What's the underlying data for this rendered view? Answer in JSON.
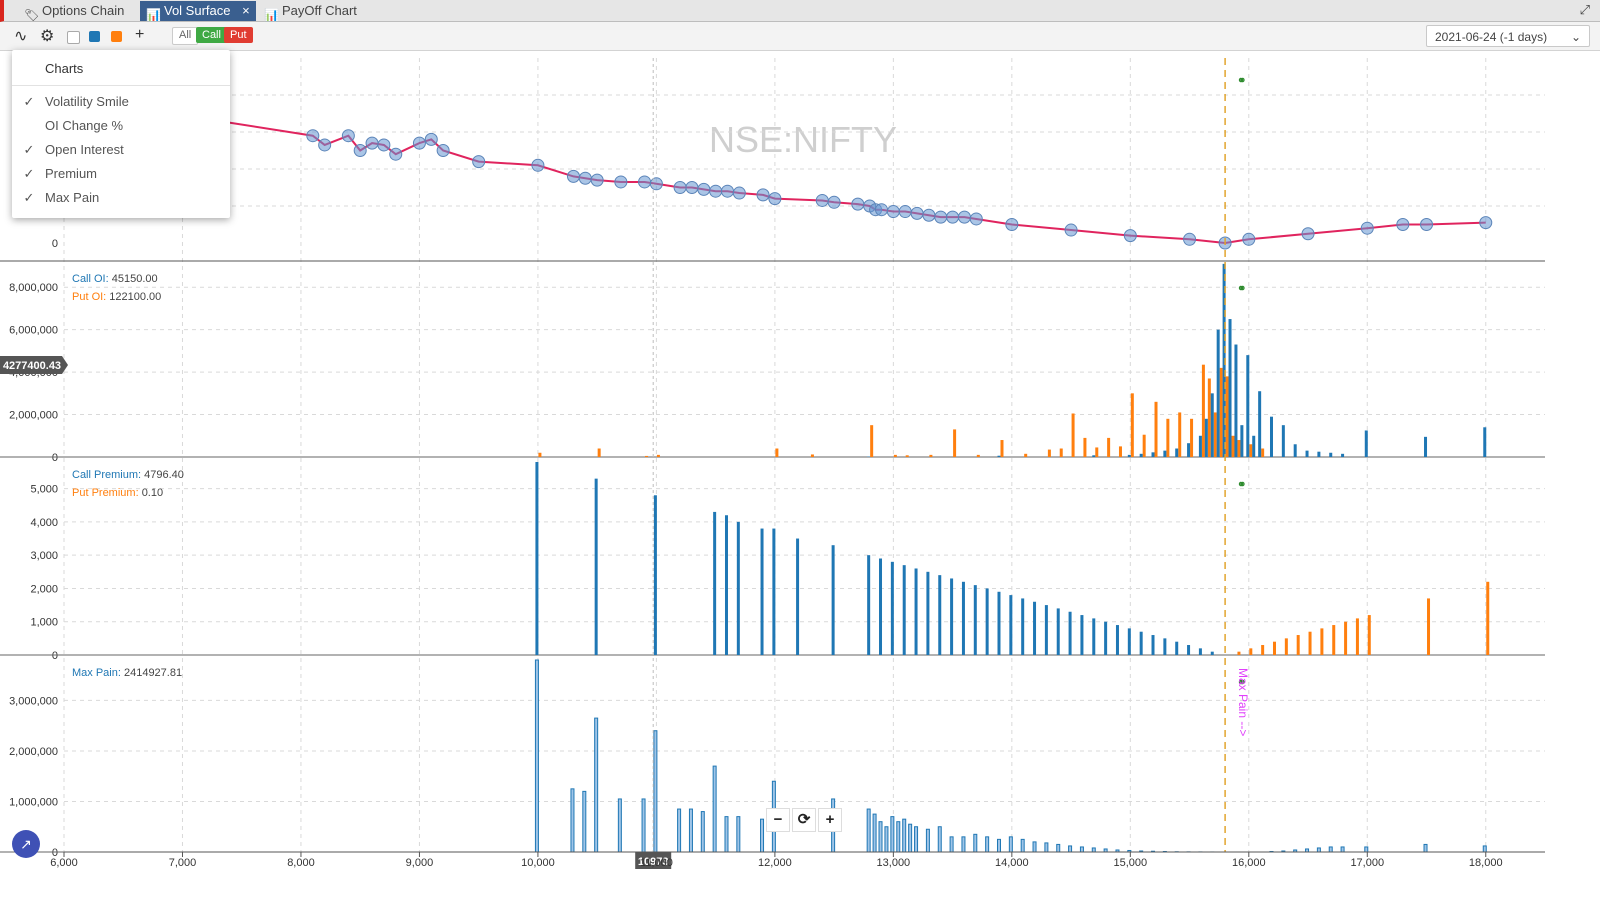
{
  "tabs": [
    {
      "label": "Options Chain",
      "icon": "tag-icon",
      "active": false
    },
    {
      "label": "Vol Surface",
      "icon": "chart-icon",
      "active": true
    },
    {
      "label": "PayOff Chart",
      "icon": "chart-icon",
      "active": false
    }
  ],
  "tab_close_glyph": "×",
  "toolbar": {
    "filter_all": "All",
    "filter_call": "Call",
    "filter_put": "Put",
    "date_value": "2021-06-24 (-1 days)",
    "swatch_colors": [
      "#ffffff",
      "#1f77b4",
      "#ff7f0e"
    ]
  },
  "menu": {
    "title": "Charts",
    "items": [
      {
        "label": "Volatility Smile",
        "checked": true
      },
      {
        "label": "OI Change %",
        "checked": false
      },
      {
        "label": "Open Interest",
        "checked": true
      },
      {
        "label": "Premium",
        "checked": true
      },
      {
        "label": "Max Pain",
        "checked": true
      }
    ]
  },
  "zoom": {
    "minus": "−",
    "reset": "⟳",
    "plus": "+"
  },
  "chart_data": {
    "watermark": "NSE:NIFTY",
    "colors": {
      "call": "#1f77b4",
      "put": "#ff7f0e",
      "smile": "#e0245e",
      "maxpain": "#e2a52e",
      "maxpain_label": "#e040fb",
      "crosshair_x": "10973"
    },
    "x_axis": {
      "min": 6000,
      "max": 18500,
      "ticks": [
        "6,000",
        "7,000",
        "8,000",
        "9,000",
        "10,000",
        "11,000",
        "12,000",
        "13,000",
        "14,000",
        "15,000",
        "16,000",
        "17,000",
        "18,000"
      ],
      "tick_values": [
        6000,
        7000,
        8000,
        9000,
        10000,
        11000,
        12000,
        13000,
        14000,
        15000,
        16000,
        17000,
        18000
      ]
    },
    "crosshair": {
      "x": 10973,
      "label": "10973",
      "y_label": "4277400.43"
    },
    "max_pain_strike": 15800,
    "max_pain_text": "Max Pain -->",
    "panels": [
      {
        "type": "line",
        "name": "volatility_smile",
        "yticks": [
          "0"
        ],
        "ymin": 0,
        "ymax": 1.0,
        "series": [
          {
            "x": [
              7300,
              8100,
              8200,
              8400,
              8500,
              8600,
              8700,
              8800,
              9000,
              9100,
              9200,
              9500,
              10000,
              10300,
              10400,
              10500,
              10700,
              10900,
              11000,
              11200,
              11300,
              11400,
              11500,
              11600,
              11700,
              11900,
              12000,
              12400,
              12500,
              12700,
              12800,
              12850,
              12900,
              13000,
              13100,
              13200,
              13300,
              13400,
              13500,
              13600,
              13700,
              14000,
              14500,
              15000,
              15500,
              15800,
              16000,
              16500,
              17000,
              17300,
              17500,
              18000
            ],
            "y": [
              0.66,
              0.58,
              0.53,
              0.58,
              0.5,
              0.54,
              0.53,
              0.48,
              0.54,
              0.56,
              0.5,
              0.44,
              0.42,
              0.36,
              0.35,
              0.34,
              0.33,
              0.33,
              0.32,
              0.3,
              0.3,
              0.29,
              0.28,
              0.28,
              0.27,
              0.26,
              0.24,
              0.23,
              0.22,
              0.21,
              0.2,
              0.18,
              0.18,
              0.17,
              0.17,
              0.16,
              0.15,
              0.14,
              0.14,
              0.14,
              0.13,
              0.1,
              0.07,
              0.04,
              0.02,
              0.0,
              0.02,
              0.05,
              0.08,
              0.1,
              0.1,
              0.11
            ]
          }
        ]
      },
      {
        "type": "bar",
        "name": "open_interest",
        "yticks": [
          "0",
          "2,000,000",
          "4,000,000",
          "6,000,000",
          "8,000,000"
        ],
        "ytick_values": [
          0,
          2000000,
          4000000,
          6000000,
          8000000
        ],
        "ymin": 0,
        "ymax": 9000000,
        "legend": [
          {
            "label": "Call OI",
            "value": "45150.00",
            "color": "#1f77b4"
          },
          {
            "label": "Put OI",
            "value": "122100.00",
            "color": "#ff7f0e"
          }
        ],
        "call": {
          "x": [
            12800,
            13900,
            14700,
            15000,
            15100,
            15200,
            15300,
            15400,
            15500,
            15600,
            15650,
            15700,
            15750,
            15800,
            15850,
            15900,
            15950,
            16000,
            16050,
            16100,
            16200,
            16300,
            16400,
            16500,
            16600,
            16700,
            16800,
            17000,
            17500,
            18000
          ],
          "y": [
            20000,
            60000,
            80000,
            100000,
            150000,
            220000,
            300000,
            400000,
            650000,
            1000000,
            1800000,
            3000000,
            6000000,
            9100000,
            6500000,
            5300000,
            1500000,
            4800000,
            1000000,
            3100000,
            1900000,
            1500000,
            600000,
            300000,
            250000,
            200000,
            150000,
            1250000,
            950000,
            1400000
          ]
        },
        "put": {
          "x": [
            10000,
            10500,
            10900,
            11000,
            12000,
            12300,
            12800,
            13000,
            13100,
            13300,
            13500,
            13700,
            13900,
            14100,
            14300,
            14400,
            14500,
            14600,
            14700,
            14800,
            14900,
            15000,
            15100,
            15200,
            15300,
            15400,
            15500,
            15600,
            15650,
            15700,
            15750,
            15800,
            15850,
            15900,
            16000,
            16100
          ],
          "y": [
            200000,
            400000,
            50000,
            100000,
            400000,
            120000,
            1500000,
            100000,
            80000,
            100000,
            1300000,
            100000,
            800000,
            150000,
            350000,
            400000,
            2050000,
            900000,
            450000,
            900000,
            500000,
            3000000,
            1050000,
            2600000,
            1800000,
            2100000,
            1800000,
            4350000,
            3700000,
            2100000,
            4200000,
            3800000,
            1000000,
            800000,
            600000,
            400000
          ]
        }
      },
      {
        "type": "bar",
        "name": "premium",
        "yticks": [
          "0",
          "1,000",
          "2,000",
          "3,000",
          "4,000",
          "5,000"
        ],
        "ytick_values": [
          0,
          1000,
          2000,
          3000,
          4000,
          5000
        ],
        "ymin": 0,
        "ymax": 5800,
        "legend": [
          {
            "label": "Call Premium",
            "value": "4796.40",
            "color": "#1f77b4"
          },
          {
            "label": "Put Premium",
            "value": "0.10",
            "color": "#ff7f0e"
          }
        ],
        "call": {
          "x": [
            10000,
            10500,
            11000,
            11500,
            11600,
            11700,
            11900,
            12000,
            12200,
            12500,
            12800,
            12900,
            13000,
            13100,
            13200,
            13300,
            13400,
            13500,
            13600,
            13700,
            13800,
            13900,
            14000,
            14100,
            14200,
            14300,
            14400,
            14500,
            14600,
            14700,
            14800,
            14900,
            15000,
            15100,
            15200,
            15300,
            15400,
            15500,
            15600,
            15700
          ],
          "y": [
            5800,
            5300,
            4800,
            4300,
            4200,
            4000,
            3800,
            3800,
            3500,
            3300,
            3000,
            2900,
            2800,
            2700,
            2600,
            2500,
            2400,
            2300,
            2200,
            2100,
            2000,
            1900,
            1800,
            1700,
            1600,
            1500,
            1400,
            1300,
            1200,
            1100,
            1000,
            900,
            800,
            700,
            600,
            500,
            400,
            300,
            200,
            100
          ]
        },
        "put": {
          "x": [
            15900,
            16000,
            16100,
            16200,
            16300,
            16400,
            16500,
            16600,
            16700,
            16800,
            16900,
            17000,
            17500,
            18000
          ],
          "y": [
            100,
            200,
            300,
            400,
            500,
            600,
            700,
            800,
            900,
            1000,
            1100,
            1200,
            1700,
            2200
          ]
        }
      },
      {
        "type": "bar",
        "name": "max_pain",
        "yticks": [
          "0",
          "1,000,000",
          "2,000,000",
          "3,000,000"
        ],
        "ytick_values": [
          0,
          1000000,
          2000000,
          3000000
        ],
        "ymin": 0,
        "ymax": 3800000,
        "legend": [
          {
            "label": "Max Pain",
            "value": "2414927.81",
            "color": "#1f77b4"
          }
        ],
        "call": {
          "x": [
            10000,
            10300,
            10400,
            10500,
            10700,
            10900,
            11000,
            11200,
            11300,
            11400,
            11500,
            11600,
            11700,
            11900,
            12000,
            12500,
            12800,
            12850,
            12900,
            12950,
            13000,
            13050,
            13100,
            13150,
            13200,
            13300,
            13400,
            13500,
            13600,
            13700,
            13800,
            13900,
            14000,
            14100,
            14200,
            14300,
            14400,
            14500,
            14600,
            14700,
            14800,
            14900,
            15000,
            15100,
            15200,
            15300,
            15400,
            15500,
            15600,
            15700,
            16200,
            16300,
            16400,
            16500,
            16600,
            16700,
            16800,
            17000,
            17500,
            18000
          ],
          "y": [
            3800000,
            1250000,
            1200000,
            2650000,
            1050000,
            1050000,
            2400000,
            850000,
            850000,
            800000,
            1700000,
            700000,
            700000,
            650000,
            1400000,
            1050000,
            850000,
            750000,
            600000,
            500000,
            700000,
            600000,
            650000,
            550000,
            500000,
            450000,
            500000,
            300000,
            300000,
            350000,
            300000,
            250000,
            300000,
            250000,
            200000,
            180000,
            150000,
            120000,
            100000,
            80000,
            60000,
            40000,
            30000,
            20000,
            15000,
            10000,
            5000,
            3000,
            2000,
            1000,
            10000,
            20000,
            40000,
            60000,
            80000,
            100000,
            100000,
            100000,
            150000,
            120000
          ]
        }
      }
    ]
  }
}
